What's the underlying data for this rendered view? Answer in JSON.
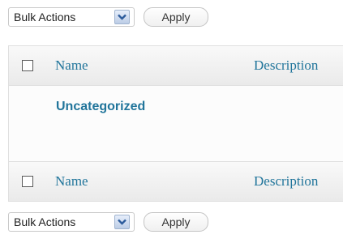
{
  "top_nav": {
    "bulk_actions_value": "Bulk Actions",
    "apply_label": "Apply"
  },
  "table": {
    "header": {
      "name": "Name",
      "description": "Description"
    },
    "rows": [
      {
        "name": "Uncategorized"
      }
    ],
    "footer": {
      "name": "Name",
      "description": "Description"
    }
  },
  "bottom_nav": {
    "bulk_actions_value": "Bulk Actions",
    "apply_label": "Apply"
  },
  "colors": {
    "link": "#21759b",
    "border": "#dfdfdf",
    "header_bg": "#eaeaea"
  },
  "icons": {
    "dropdown": "chevron-down-icon"
  }
}
